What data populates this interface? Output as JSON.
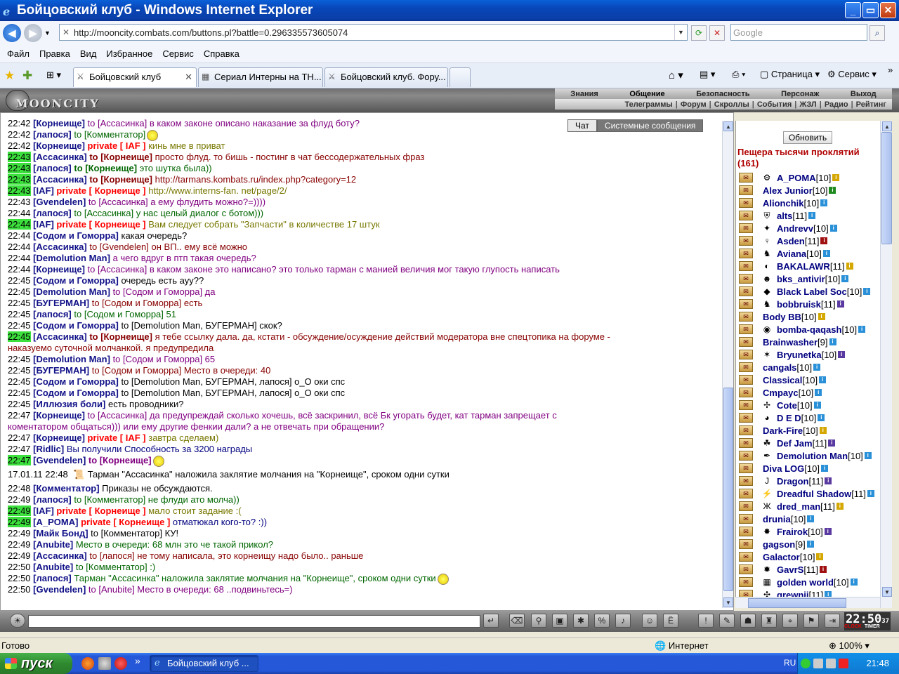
{
  "window": {
    "title": "Бойцовский клуб - Windows Internet Explorer",
    "minimize": "_",
    "maximize": "▭",
    "close": "✕"
  },
  "address": {
    "url": "http://mooncity.combats.com/buttons.pl?battle=0.296335573605074",
    "search_placeholder": "Google"
  },
  "menu": [
    "Файл",
    "Правка",
    "Вид",
    "Избранное",
    "Сервис",
    "Справка"
  ],
  "tabs": [
    {
      "label": "Бойцовский клуб",
      "active": true
    },
    {
      "label": "Сериал Интерны на ТН...",
      "active": false
    },
    {
      "label": "Бойцовский клуб. Фору...",
      "active": false
    }
  ],
  "right_tools": {
    "page": "Страница",
    "service": "Сервис"
  },
  "game": {
    "logo": "MOONCITY",
    "nav_top": [
      "Знания",
      "Общение",
      "Безопасность",
      "Персонаж",
      "Выход"
    ],
    "nav_bottom": [
      "Телеграммы",
      "Форум",
      "Скроллы",
      "События",
      "ЖЗЛ",
      "Радио",
      "Рейтинг"
    ],
    "chat_tab": "Чат",
    "sys_tab": "Системные сообщения"
  },
  "chat": [
    {
      "time": "22:42",
      "hl": false,
      "nick": "Корнеище",
      "to": "to [Ассасинка] в каком законе описано наказание за флуд боту?",
      "cls": "msg-purple"
    },
    {
      "time": "22:42",
      "hl": false,
      "nick": "лапося",
      "to": "to [Комментатор]",
      "cls": "msg-green",
      "smiley": true
    },
    {
      "time": "22:42",
      "hl": false,
      "nick": "Корнеище",
      "priv": "private [ IAF ]",
      "text": " кинь мне в приват",
      "cls": "msg-olive"
    },
    {
      "time": "22:43",
      "hl": true,
      "nick": "Ассасинка",
      "tob": "to [Корнеище]",
      "text": " просто флуд. то бишь - постинг в чат бессодержательных фраз",
      "cls": "msg-darkred"
    },
    {
      "time": "22:43",
      "hl": true,
      "nick": "лапося",
      "tob": "to [Корнеище]",
      "text": " это шутка была))",
      "cls": "msg-green"
    },
    {
      "time": "22:43",
      "hl": true,
      "nick": "Ассасинка",
      "tob": "to [Корнеище]",
      "text": " http://tarmans.kombats.ru/index.php?category=12",
      "cls": "msg-darkred"
    },
    {
      "time": "22:43",
      "hl": true,
      "nick": "IAF",
      "priv": "private [ Корнеище ]",
      "text": " http://www.interns-fan. net/page/2/",
      "cls": "msg-olive"
    },
    {
      "time": "22:43",
      "hl": false,
      "nick": "Gvendelen",
      "to": "to [Ассасинка] а ему флудить можно?=))))",
      "cls": "msg-purple"
    },
    {
      "time": "22:44",
      "hl": false,
      "nick": "лапося",
      "to": "to [Ассасинка] у нас целый диалог с ботом)))",
      "cls": "msg-green"
    },
    {
      "time": "22:44",
      "hl": true,
      "nick": "IAF",
      "priv": "private [ Корнеище ]",
      "text": " Вам следует собрать \"Запчасти\" в количестве 17 штук",
      "cls": "msg-olive"
    },
    {
      "time": "22:44",
      "hl": false,
      "nick": "Содом и Гоморра",
      "to": "какая очередь?",
      "cls": "msg-black"
    },
    {
      "time": "22:44",
      "hl": false,
      "nick": "Ассасинка",
      "to": "to [Gvendelen] он ВП.. ему всё можно",
      "cls": "msg-darkred"
    },
    {
      "time": "22:44",
      "hl": false,
      "nick": "Demolution Man",
      "to": "а чего вдруг в птп такая очередь?",
      "cls": "msg-purple"
    },
    {
      "time": "22:44",
      "hl": false,
      "nick": "Корнеище",
      "to": "to [Ассасинка] в каком законе это написано? это только тарман с манией величия мог такую глупость написать",
      "cls": "msg-purple"
    },
    {
      "time": "22:45",
      "hl": false,
      "nick": "Содом и Гоморра",
      "to": "очередь есть ауу??",
      "cls": "msg-black"
    },
    {
      "time": "22:45",
      "hl": false,
      "nick": "Demolution Man",
      "to": "to [Содом и Гоморра] да",
      "cls": "msg-purple"
    },
    {
      "time": "22:45",
      "hl": false,
      "nick": "БУГЕРМАН",
      "to": "to [Содом и Гоморра] есть",
      "cls": "msg-darkred"
    },
    {
      "time": "22:45",
      "hl": false,
      "nick": "лапося",
      "to": "to [Содом и Гоморра] 51",
      "cls": "msg-green"
    },
    {
      "time": "22:45",
      "hl": false,
      "nick": "Содом и Гоморра",
      "to": "to [Demolution Man, БУГЕРМАН] скок?",
      "cls": "msg-black"
    },
    {
      "time": "22:45",
      "hl": true,
      "nick": "Ассасинка",
      "tob": "to [Корнеище]",
      "text": " я тебе ссылку дала. да, кстати - обсуждение/осуждение действий модератора вне спецтопика на форуме -",
      "cls": "msg-darkred"
    },
    {
      "time": "",
      "hl": false,
      "cont": "наказуемо суточной молчанкой. я предупредила",
      "cls": "msg-darkred"
    },
    {
      "time": "22:45",
      "hl": false,
      "nick": "Demolution Man",
      "to": "to [Содом и Гоморра] 65",
      "cls": "msg-purple"
    },
    {
      "time": "22:45",
      "hl": false,
      "nick": "БУГЕРМАН",
      "to": "to [Содом и Гоморра] Место в очереди: 40",
      "cls": "msg-darkred"
    },
    {
      "time": "22:45",
      "hl": false,
      "nick": "Содом и Гоморра",
      "to": "to [Demolution Man, БУГЕРМАН, лапося] о_О оки спс",
      "cls": "msg-black"
    },
    {
      "time": "22:45",
      "hl": false,
      "nick": "Содом и Гоморра",
      "to": "to [Demolution Man, БУГЕРМАН, лапося] о_О оки спс",
      "cls": "msg-black"
    },
    {
      "time": "22:45",
      "hl": false,
      "nick": "Иллюзия боли",
      "to": "есть проводники?",
      "cls": "msg-black"
    },
    {
      "time": "22:47",
      "hl": false,
      "nick": "Корнеище",
      "to": "to [Ассасинка] да предупреждай сколько хочешь, всё заскринил, всё Бк угорать будет, кат тарман запрещает с",
      "cls": "msg-purple"
    },
    {
      "time": "",
      "hl": false,
      "cont": "коментатором общаться))) или ему другие фенкии дали? а не отвечать при обращении?",
      "cls": "msg-purple"
    },
    {
      "time": "22:47",
      "hl": false,
      "nick": "Корнеище",
      "priv": "private [ IAF ]",
      "text": " завтра сделаем)",
      "cls": "msg-olive"
    },
    {
      "time": "22:47",
      "hl": false,
      "nick": "Ridlic",
      "to": "Вы получили Способность за 3200 награды",
      "cls": "msg-navy"
    },
    {
      "time": "22:47",
      "hl": true,
      "nick": "Gvendelen",
      "tob": "to [Корнеище]",
      "text": "",
      "cls": "msg-purple",
      "smiley": true
    },
    {
      "time": "17.01.11 22:48",
      "hl": false,
      "sys": "Тарман \"Ассасинка\" наложила заклятие молчания на \"Корнеище\", сроком одни сутки",
      "cls": "msg-black"
    },
    {
      "time": "22:48",
      "hl": false,
      "nick": "Комментатор",
      "to": "Приказы не обсуждаются.",
      "cls": "msg-black"
    },
    {
      "time": "22:49",
      "hl": false,
      "nick": "лапося",
      "to": "to [Комментатор] не флуди ато молча))",
      "cls": "msg-green"
    },
    {
      "time": "22:49",
      "hl": true,
      "nick": "IAF",
      "priv": "private [ Корнеище ]",
      "text": " мало стоит задание :(",
      "cls": "msg-olive"
    },
    {
      "time": "22:49",
      "hl": true,
      "nick": "A_POMA",
      "priv": "private [ Корнеище ]",
      "text": " отматюкал кого-то? :))",
      "cls": "msg-navy"
    },
    {
      "time": "22:49",
      "hl": false,
      "nick": "Майк Бонд",
      "to": "to [Комментатор] КУ!",
      "cls": "msg-black"
    },
    {
      "time": "22:49",
      "hl": false,
      "nick": "Anubite",
      "to": "Место в очереди: 68 млн это че такой прикол?",
      "cls": "msg-green"
    },
    {
      "time": "22:49",
      "hl": false,
      "nick": "Ассасинка",
      "to": "to [лапося] не тому написала, это корнеищу надо было.. раньше",
      "cls": "msg-darkred"
    },
    {
      "time": "22:50",
      "hl": false,
      "nick": "Anubite",
      "to": "to [Комментатор] :)",
      "cls": "msg-green"
    },
    {
      "time": "22:50",
      "hl": false,
      "nick": "лапося",
      "to": "Тарман \"Ассасинка\" наложила заклятие молчания на \"Корнеище\", сроком одни сутки",
      "cls": "msg-green",
      "smiley": true
    },
    {
      "time": "22:50",
      "hl": false,
      "nick": "Gvendelen",
      "to": "to [Anubite] Место в очереди: 68 ..подвиньтесь=)",
      "cls": "msg-purple"
    }
  ],
  "room": {
    "refresh": "Обновить",
    "title": "Пещера тысячи проклятий",
    "count": "(161)"
  },
  "users": [
    {
      "name": "A_POMA",
      "lvl": "[10]",
      "emb": "⚙",
      "info_color": "#D4A800"
    },
    {
      "name": "Alex Junior",
      "lvl": "[10]",
      "emb": "",
      "info_color": "#1E8A1E"
    },
    {
      "name": "Alionchik",
      "lvl": "[10]",
      "emb": "",
      "info_color": "#2A90D8"
    },
    {
      "name": "alts",
      "lvl": "[11]",
      "emb": "⛨",
      "info_color": "#2A90D8"
    },
    {
      "name": "Andrevv",
      "lvl": "[10]",
      "emb": "✦",
      "info_color": "#2A90D8"
    },
    {
      "name": "Asden",
      "lvl": "[11]",
      "emb": "♀",
      "info_color": "#A01010"
    },
    {
      "name": "Aviana",
      "lvl": "[10]",
      "emb": "♞",
      "info_color": "#2A90D8"
    },
    {
      "name": "BAKALAWR",
      "lvl": "[11]",
      "emb": "◐",
      "info_color": "#D4A800"
    },
    {
      "name": "bks_antivir",
      "lvl": "[10]",
      "emb": "☻",
      "info_color": "#2A90D8"
    },
    {
      "name": "Black Label Soc",
      "lvl": "[10]",
      "emb": "◆",
      "info_color": "#2A90D8"
    },
    {
      "name": "bobbruisk",
      "lvl": "[11]",
      "emb": "♞",
      "info_color": "#5A3AA0"
    },
    {
      "name": "Body BB",
      "lvl": "[10]",
      "emb": "",
      "info_color": "#D4A800"
    },
    {
      "name": "bomba-qaqash",
      "lvl": "[10]",
      "emb": "◉",
      "info_color": "#2A90D8"
    },
    {
      "name": "Brainwasher",
      "lvl": "[9]",
      "emb": "",
      "info_color": "#2A90D8"
    },
    {
      "name": "Bryunetka",
      "lvl": "[10]",
      "emb": "✶",
      "info_color": "#5A3AA0"
    },
    {
      "name": "cangals",
      "lvl": "[10]",
      "emb": "",
      "info_color": "#2A90D8"
    },
    {
      "name": "Classical",
      "lvl": "[10]",
      "emb": "",
      "info_color": "#2A90D8"
    },
    {
      "name": "Cmpayc",
      "lvl": "[10]",
      "emb": "",
      "info_color": "#2A90D8"
    },
    {
      "name": "Cote",
      "lvl": "[10]",
      "emb": "✢",
      "info_color": "#2A90D8"
    },
    {
      "name": "D E D",
      "lvl": "[10]",
      "emb": "◕",
      "info_color": "#2A90D8"
    },
    {
      "name": "Dark-Fire",
      "lvl": "[10]",
      "emb": "",
      "info_color": "#D4A800"
    },
    {
      "name": "Def Jam",
      "lvl": "[11]",
      "emb": "☘",
      "info_color": "#5A3AA0"
    },
    {
      "name": "Demolution Man",
      "lvl": "[10]",
      "emb": "✒",
      "info_color": "#2A90D8"
    },
    {
      "name": "Diva LOG",
      "lvl": "[10]",
      "emb": "",
      "info_color": "#2A90D8"
    },
    {
      "name": "Dragon",
      "lvl": "[11]",
      "emb": "J",
      "info_color": "#5A3AA0"
    },
    {
      "name": "Dreadful Shadow",
      "lvl": "[11]",
      "emb": "⚡",
      "info_color": "#2A90D8"
    },
    {
      "name": "dred_man",
      "lvl": "[11]",
      "emb": "Ж",
      "info_color": "#D4A800"
    },
    {
      "name": "drunia",
      "lvl": "[10]",
      "emb": "",
      "info_color": "#2A90D8"
    },
    {
      "name": "Frairok",
      "lvl": "[10]",
      "emb": "✸",
      "info_color": "#5A3AA0"
    },
    {
      "name": "gagson",
      "lvl": "[9]",
      "emb": "",
      "info_color": "#2A90D8"
    },
    {
      "name": "Galactor",
      "lvl": "[10]",
      "emb": "",
      "info_color": "#D4A800"
    },
    {
      "name": "GavrS",
      "lvl": "[11]",
      "emb": "✹",
      "info_color": "#A01010"
    },
    {
      "name": "golden world",
      "lvl": "[10]",
      "emb": "▦",
      "info_color": "#2A90D8"
    },
    {
      "name": "grewnii",
      "lvl": "[11]",
      "emb": "✣",
      "info_color": "#2A90D8"
    }
  ],
  "clock": {
    "time": "22:50",
    "sec": "37",
    "label_clock": "CLOCK",
    "label_timer": "TIMER"
  },
  "status": {
    "text": "Готово",
    "zone": "Интернет",
    "zoom": "100%"
  },
  "taskbar": {
    "start": "пуск",
    "task": "Бойцовский клуб ...",
    "lang": "RU",
    "time": "21:48"
  }
}
